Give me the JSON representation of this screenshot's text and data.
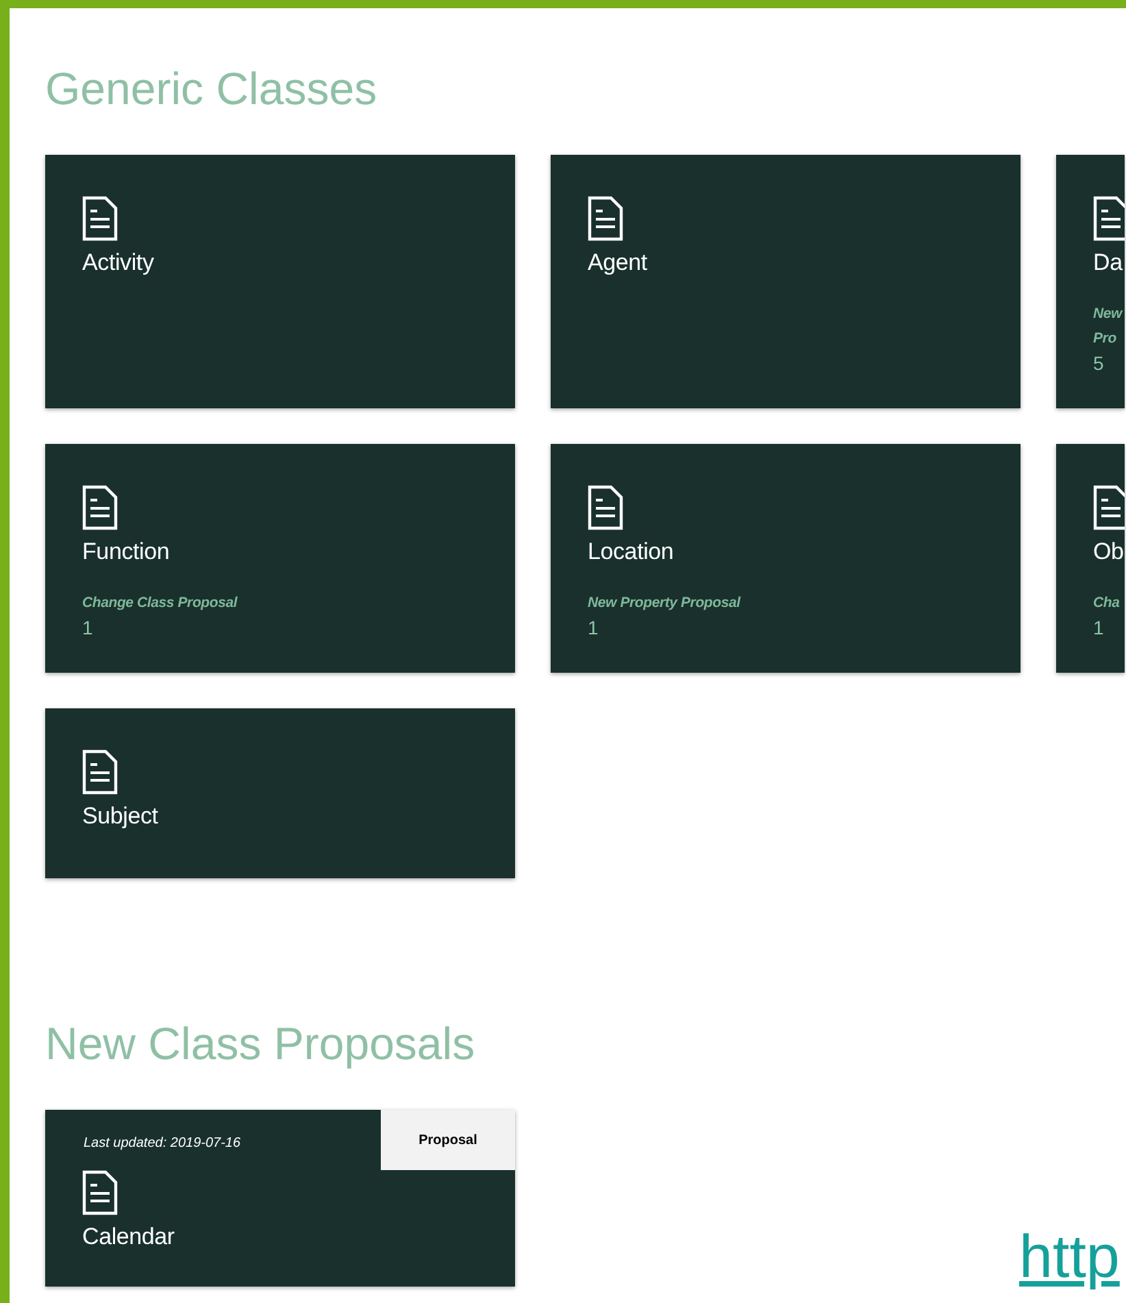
{
  "sections": [
    {
      "title": "Generic Classes",
      "cards": [
        {
          "title": "Activity"
        },
        {
          "title": "Agent"
        },
        {
          "title": "Da",
          "proposal": {
            "label": "New Pro",
            "count": "5"
          }
        },
        {
          "title": "Function",
          "proposal": {
            "label": "Change Class Proposal",
            "count": "1"
          }
        },
        {
          "title": "Location",
          "proposal": {
            "label": "New Property Proposal",
            "count": "1"
          }
        },
        {
          "title": "Ob",
          "proposal": {
            "label": "Cha",
            "count": "1"
          }
        },
        {
          "title": "Subject"
        }
      ]
    },
    {
      "title": "New Class Proposals",
      "cards": [
        {
          "title": "Calendar",
          "updated": "Last updated: 2019-07-16",
          "tag": "Proposal"
        }
      ]
    }
  ],
  "link": "http"
}
